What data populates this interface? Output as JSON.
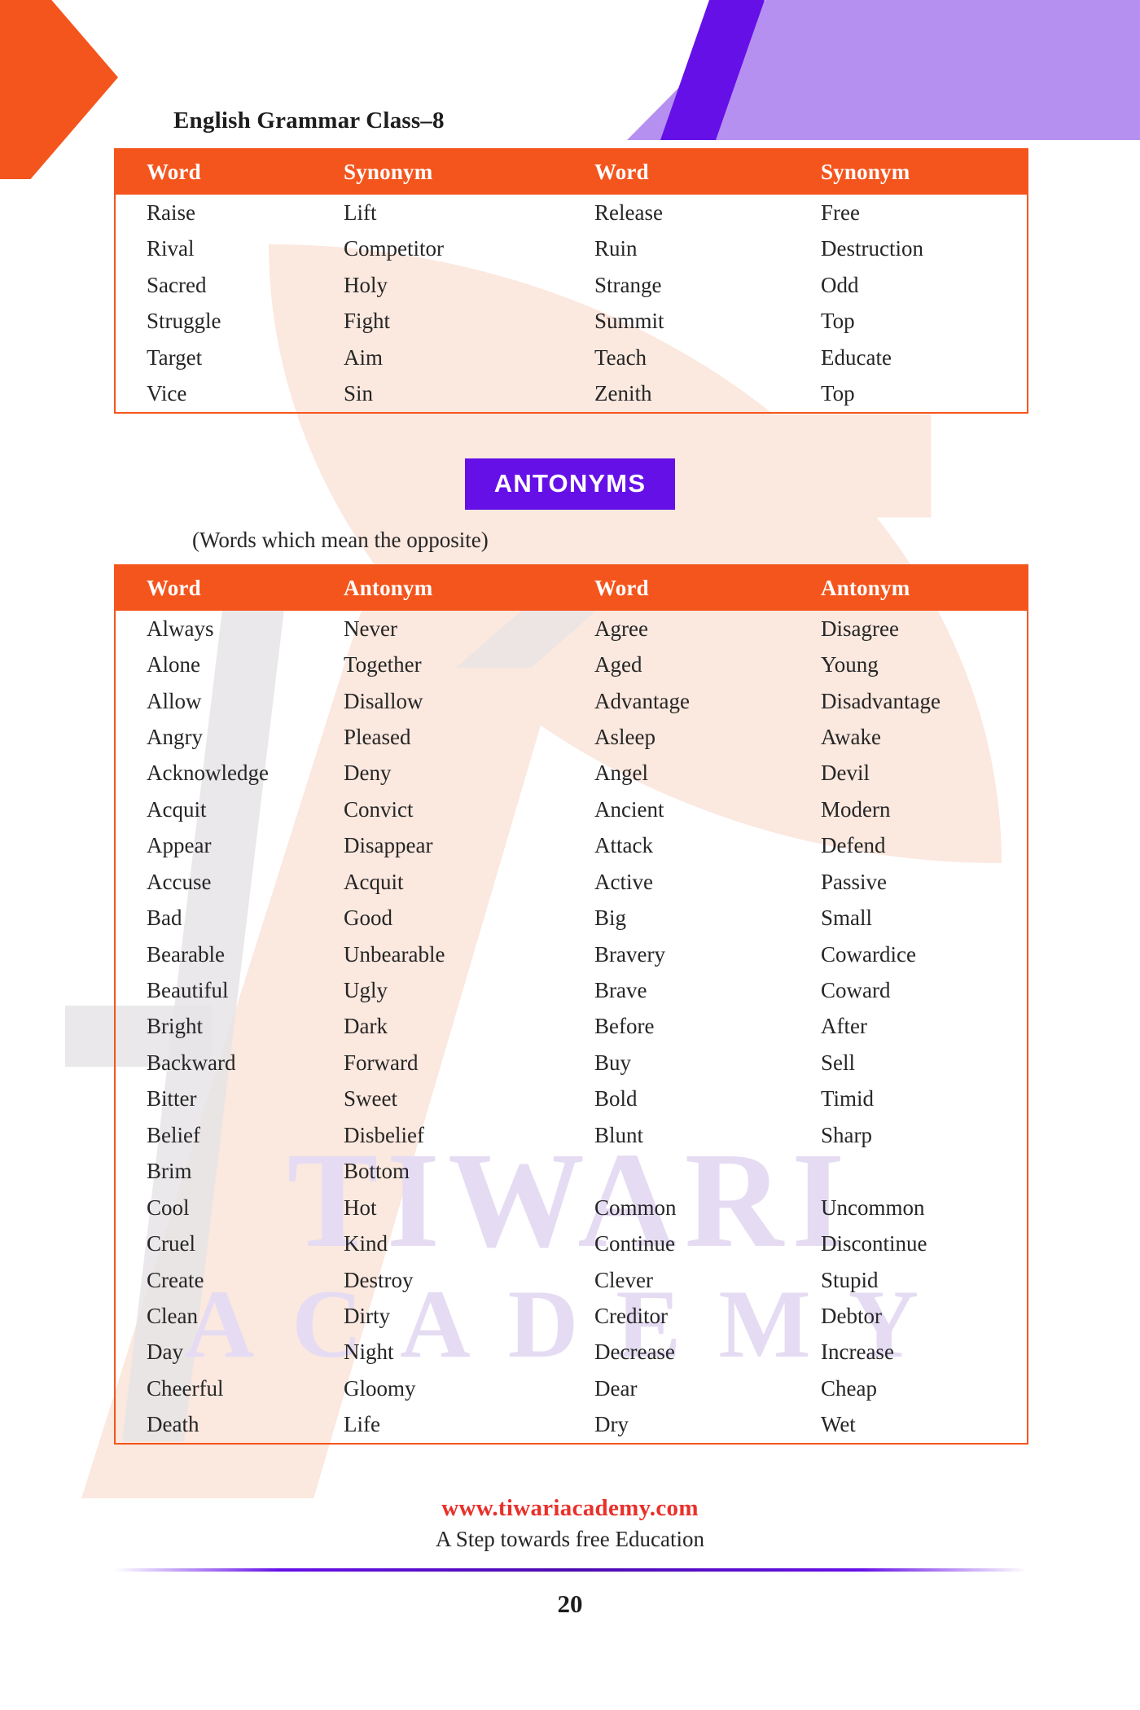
{
  "header": {
    "title": "English Grammar Class–8"
  },
  "synonyms_table": {
    "columns": [
      "Word",
      "Synonym",
      "Word",
      "Synonym"
    ],
    "rows": [
      [
        "Raise",
        "Lift",
        "Release",
        "Free"
      ],
      [
        "Rival",
        "Competitor",
        "Ruin",
        "Destruction"
      ],
      [
        "Sacred",
        "Holy",
        "Strange",
        "Odd"
      ],
      [
        "Struggle",
        "Fight",
        "Summit",
        "Top"
      ],
      [
        "Target",
        "Aim",
        "Teach",
        "Educate"
      ],
      [
        "Vice",
        "Sin",
        "Zenith",
        "Top"
      ]
    ]
  },
  "antonyms_banner": {
    "label": "ANTONYMS",
    "subtitle": "(Words which mean the opposite)"
  },
  "antonyms_table": {
    "columns": [
      "Word",
      "Antonym",
      "Word",
      "Antonym"
    ],
    "rows": [
      [
        "Always",
        "Never",
        "Agree",
        "Disagree"
      ],
      [
        "Alone",
        "Together",
        "Aged",
        "Young"
      ],
      [
        "Allow",
        "Disallow",
        "Advantage",
        "Disadvantage"
      ],
      [
        "Angry",
        "Pleased",
        "Asleep",
        "Awake"
      ],
      [
        "Acknowledge",
        "Deny",
        "Angel",
        "Devil"
      ],
      [
        "Acquit",
        "Convict",
        "Ancient",
        "Modern"
      ],
      [
        "Appear",
        "Disappear",
        "Attack",
        "Defend"
      ],
      [
        "Accuse",
        "Acquit",
        "Active",
        "Passive"
      ],
      [
        "Bad",
        "Good",
        "Big",
        "Small"
      ],
      [
        "Bearable",
        "Unbearable",
        "Bravery",
        "Cowardice"
      ],
      [
        "Beautiful",
        "Ugly",
        "Brave",
        "Coward"
      ],
      [
        "Bright",
        "Dark",
        "Before",
        "After"
      ],
      [
        "Backward",
        "Forward",
        "Buy",
        "Sell"
      ],
      [
        "Bitter",
        "Sweet",
        "Bold",
        "Timid"
      ],
      [
        "Belief",
        "Disbelief",
        "Blunt",
        "Sharp"
      ],
      [
        "Brim",
        "Bottom",
        "",
        ""
      ],
      [
        "Cool",
        "Hot",
        "Common",
        "Uncommon"
      ],
      [
        "Cruel",
        "Kind",
        "Continue",
        "Discontinue"
      ],
      [
        "Create",
        "Destroy",
        "Clever",
        "Stupid"
      ],
      [
        "Clean",
        "Dirty",
        "Creditor",
        "Debtor"
      ],
      [
        "Day",
        "Night",
        "Decrease",
        "Increase"
      ],
      [
        "Cheerful",
        "Gloomy",
        "Dear",
        "Cheap"
      ],
      [
        "Death",
        "Life",
        "Dry",
        "Wet"
      ]
    ]
  },
  "footer": {
    "site": "www.tiwariacademy.com",
    "tagline": "A Step towards free Education",
    "page_number": "20"
  },
  "watermark": {
    "line1": "TIWARI",
    "line2": "ACADEMY"
  },
  "colors": {
    "orange": "#f4551d",
    "violet": "#6610e8",
    "lilac": "#b690f0",
    "peach": "#fbe8df",
    "red": "#e8302a"
  }
}
